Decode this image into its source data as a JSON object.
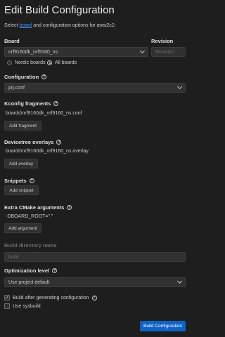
{
  "header": {
    "title": "Edit Build Configuration",
    "subtitle_pre": "Select ",
    "subtitle_link": "board",
    "subtitle_post": " and configuration options for awsi2c2:"
  },
  "board": {
    "label": "Board",
    "value": "nrf9160dk_nrf9160_ns",
    "radio_nordic": "Nordic boards",
    "radio_all": "All boards",
    "selected_radio": "all"
  },
  "revision": {
    "label": "Revision",
    "placeholder": "Revision"
  },
  "configuration": {
    "label": "Configuration",
    "value": "prj.conf"
  },
  "kconfig": {
    "label": "Kconfig fragments",
    "value": "boards\\nrf9160dk_nrf9160_ns.conf",
    "button": "Add fragment"
  },
  "devicetree": {
    "label": "Devicetree overlays",
    "value": "boards\\nrf9160dk_nrf9160_ns.overlay",
    "button": "Add overlay"
  },
  "snippets": {
    "label": "Snippets",
    "button": "Add snippet"
  },
  "cmake": {
    "label": "Extra CMake arguments",
    "value": "-DBOARD_ROOT=\".\"",
    "button": "Add argument"
  },
  "build_dir": {
    "label": "Build directory name",
    "placeholder": "build"
  },
  "optimization": {
    "label": "Optimization level",
    "value": "Use project default"
  },
  "options": {
    "build_after": "Build after generating configuration",
    "build_after_checked": true,
    "use_sysbuild": "Use sysbuild",
    "use_sysbuild_checked": false
  },
  "footer": {
    "primary_button": "Build Configuration"
  },
  "colors": {
    "background": "#1e1e1e",
    "accent": "#0e63c5",
    "link": "#3794ff"
  }
}
